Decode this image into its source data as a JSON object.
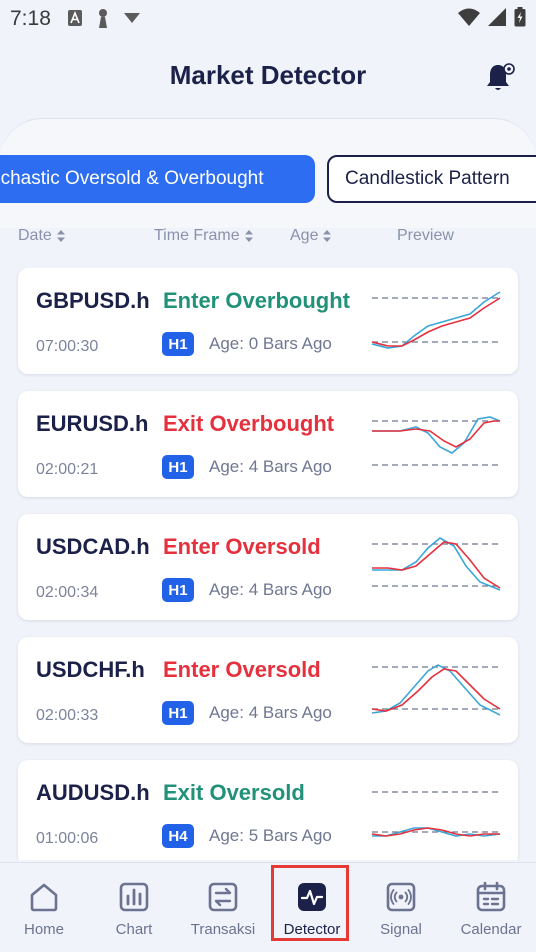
{
  "status": {
    "time": "7:18",
    "icons": [
      "a-icon",
      "figure-icon",
      "download-arrow-icon"
    ],
    "right_icons": [
      "wifi-icon",
      "cell-signal-icon",
      "battery-icon"
    ]
  },
  "header": {
    "title": "Market Detector",
    "bell_icon": "bell-settings-icon"
  },
  "tabs": [
    {
      "label": "Stochastic Oversold & Overbought",
      "visible_text": "ochastic Oversold & Overbought",
      "active": true
    },
    {
      "label": "Candlestick Pattern",
      "active": false
    }
  ],
  "columns": {
    "date": "Date",
    "time_frame": "Time Frame",
    "age": "Age",
    "preview": "Preview"
  },
  "items": [
    {
      "symbol": "GBPUSD.h",
      "signal": "Enter Overbought",
      "signal_color": "#21917a",
      "time": "07:00:30",
      "timeframe": "H1",
      "age": "Age: 0 Bars Ago"
    },
    {
      "symbol": "EURUSD.h",
      "signal": "Exit Overbought",
      "signal_color": "#e5313e",
      "time": "02:00:21",
      "timeframe": "H1",
      "age": "Age: 4 Bars Ago"
    },
    {
      "symbol": "USDCAD.h",
      "signal": "Enter Oversold",
      "signal_color": "#e5313e",
      "time": "02:00:34",
      "timeframe": "H1",
      "age": "Age: 4 Bars Ago"
    },
    {
      "symbol": "USDCHF.h",
      "signal": "Enter Oversold",
      "signal_color": "#e5313e",
      "time": "02:00:33",
      "timeframe": "H1",
      "age": "Age: 4 Bars Ago"
    },
    {
      "symbol": "AUDUSD.h",
      "signal": "Exit Oversold",
      "signal_color": "#21917a",
      "time": "01:00:06",
      "timeframe": "H4",
      "age": "Age: 5 Bars Ago"
    }
  ],
  "preview_colors": {
    "k_line": "#3aa7d8",
    "d_line": "#e5313e",
    "levels": "#6f7791"
  },
  "nav": [
    {
      "label": "Home",
      "icon": "home-icon",
      "active": false
    },
    {
      "label": "Chart",
      "icon": "bar-chart-icon",
      "active": false
    },
    {
      "label": "Transaksi",
      "icon": "transfer-icon",
      "active": false
    },
    {
      "label": "Detector",
      "icon": "pulse-icon",
      "active": true
    },
    {
      "label": "Signal",
      "icon": "broadcast-icon",
      "active": false
    },
    {
      "label": "Calendar",
      "icon": "calendar-icon",
      "active": false
    }
  ]
}
